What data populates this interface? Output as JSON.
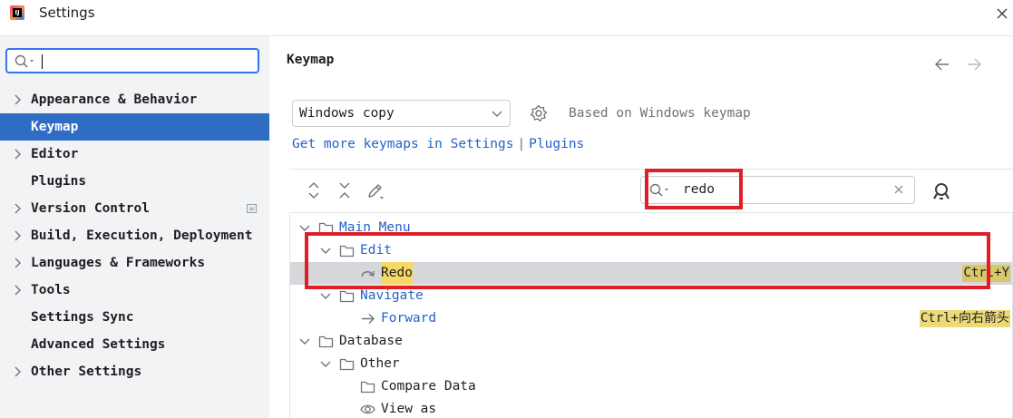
{
  "window": {
    "title": "Settings",
    "logo_text": "IJ"
  },
  "sidebar": {
    "search": {
      "value": "",
      "placeholder": ""
    },
    "items": [
      {
        "label": "Appearance & Behavior",
        "expandable": true
      },
      {
        "label": "Keymap",
        "expandable": false,
        "selected": true
      },
      {
        "label": "Editor",
        "expandable": true
      },
      {
        "label": "Plugins",
        "expandable": false
      },
      {
        "label": "Version Control",
        "expandable": true
      },
      {
        "label": "Build, Execution, Deployment",
        "expandable": true
      },
      {
        "label": "Languages & Frameworks",
        "expandable": true
      },
      {
        "label": "Tools",
        "expandable": true
      },
      {
        "label": "Settings Sync",
        "expandable": false
      },
      {
        "label": "Advanced Settings",
        "expandable": false
      },
      {
        "label": "Other Settings",
        "expandable": true
      }
    ]
  },
  "main": {
    "title": "Keymap",
    "keymap_select": {
      "value": "Windows copy"
    },
    "based_on": "Based on Windows keymap",
    "get_more": {
      "text": "Get more keymaps in Settings",
      "separator": "|",
      "link": "Plugins"
    },
    "filter": {
      "value": "redo"
    },
    "tree": [
      {
        "label": "Main Menu",
        "icon": "folder-icon",
        "blue": true,
        "expanded": true
      },
      {
        "label": "Edit",
        "icon": "folder-icon",
        "blue": true,
        "expanded": true
      },
      {
        "label": "Redo",
        "icon": "redo-icon",
        "highlight": true,
        "shortcut": "Ctrl+Y",
        "selected": true
      },
      {
        "label": "Navigate",
        "icon": "folder-icon",
        "blue": true,
        "expanded": true
      },
      {
        "label": "Forward",
        "icon": "forward-arrow-icon",
        "blue": true,
        "shortcut": "Ctrl+向右箭头"
      },
      {
        "label": "Database",
        "icon": "folder-icon",
        "expanded": true
      },
      {
        "label": "Other",
        "icon": "folder-icon",
        "expanded": true
      },
      {
        "label": "Compare Data",
        "icon": "folder-icon"
      },
      {
        "label": "View as",
        "icon": "eye-icon"
      }
    ]
  },
  "colors": {
    "accent": "#2f6cc4",
    "link": "#2561c8",
    "annotation": "#e01e28",
    "match_highlight": "#f7d765"
  }
}
